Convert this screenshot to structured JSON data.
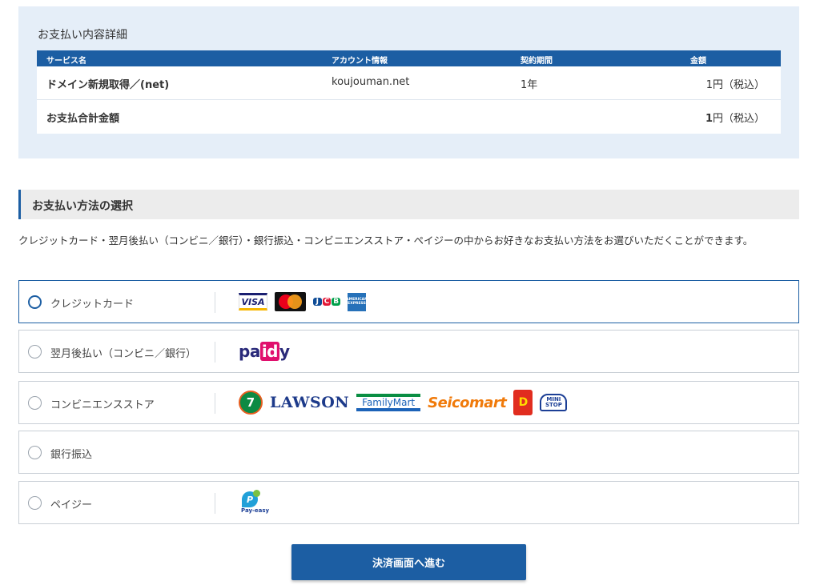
{
  "summary": {
    "title": "お支払い内容詳細",
    "headers": [
      "サービス名",
      "アカウント情報",
      "契約期間",
      "金額"
    ],
    "row": {
      "service": "ドメイン新規取得／(net)",
      "account": "koujouman.net",
      "period": "1年",
      "amount": "1円（税込）"
    },
    "total": {
      "label": "お支払合計金額",
      "amount_number": "1",
      "amount_suffix": "円（税込）"
    }
  },
  "section": {
    "title": "お支払い方法の選択",
    "description": "クレジットカード・翌月後払い（コンビニ／銀行）・銀行振込・コンビニエンスストア・ペイジーの中からお好きなお支払い方法をお選びいただくことができます。"
  },
  "methods": [
    {
      "label": "クレジットカード",
      "selected": true
    },
    {
      "label": "翌月後払い（コンビニ／銀行）",
      "selected": false
    },
    {
      "label": "コンビニエンスストア",
      "selected": false
    },
    {
      "label": "銀行振込",
      "selected": false
    },
    {
      "label": "ペイジー",
      "selected": false
    }
  ],
  "logos": {
    "visa": "VISA",
    "jcb": [
      "J",
      "C",
      "B"
    ],
    "amex": "AMERICAN EXPRESS",
    "paidy_pre": "pa",
    "paidy_mid": "id",
    "paidy_post": "y",
    "seven": "7",
    "lawson": "LAWSON",
    "familymart": "FamilyMart",
    "seicomart": "Seicomart",
    "daily": "D",
    "ministop": "MINI STOP",
    "payeasy_mark": "P",
    "payeasy_text": "Pay-easy"
  },
  "colors": {
    "accent": "#1c5ea3",
    "summary_bg": "#e5eef8",
    "section_bg": "#ececec"
  },
  "submit_label": "決済画面へ進む"
}
